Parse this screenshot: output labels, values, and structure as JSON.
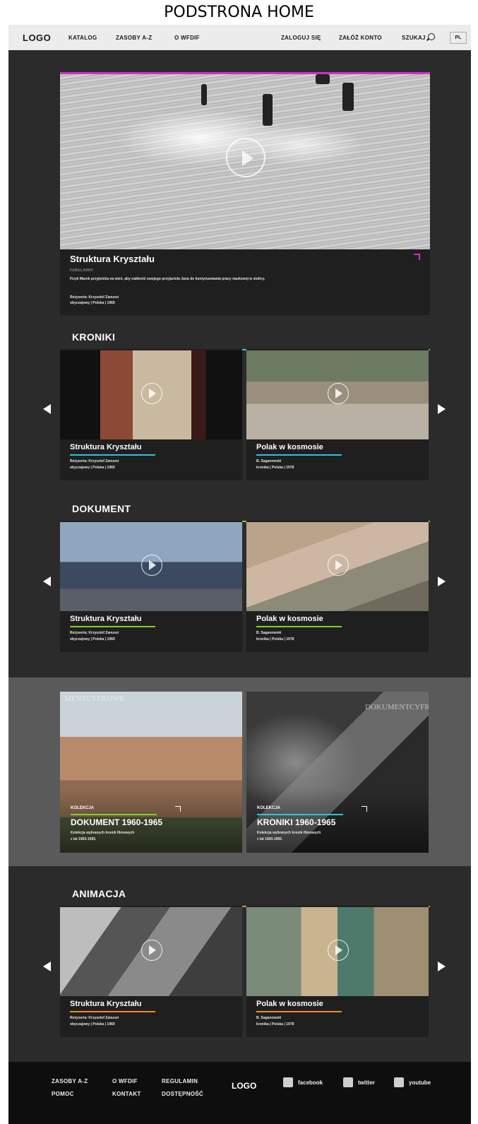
{
  "page_label": "PODSTRONA HOME",
  "nav": {
    "logo": "LOGO",
    "items": [
      "KATALOG",
      "ZASOBY A-Z",
      "O WFDIF"
    ],
    "login": "ZALOGUJ SIĘ",
    "register": "ZAŁÓŻ KONTO",
    "search": "SZUKAJ",
    "lang": "PL"
  },
  "hero": {
    "title": "Struktura Kryształu",
    "genre": "FABULARNY",
    "description": "Fizyk Marek przyjeżdża na wieś, aby nakłonić swojego przyjaciela Jana do kontynuowania pracy naukowej w stolicy.",
    "director": "Reżyseria: Krzysztof Zanussi",
    "info": "obyczajowy | Polska | 1969",
    "accent": "#d22bd0"
  },
  "sections": [
    {
      "title": "KRONIKI",
      "accent": "#2ec4d6",
      "cards": [
        {
          "title": "Struktura Kryształu",
          "line1": "Reżyseria: Krzysztof Zanussi",
          "line2": "obyczajowy | Polska | 1969"
        },
        {
          "title": "Polak w kosmosie",
          "line1": "B. Saganowski",
          "line2": "kronika | Polska | 1978"
        }
      ]
    },
    {
      "title": "DOKUMENT",
      "accent": "#7ed321",
      "cards": [
        {
          "title": "Struktura Kryształu",
          "line1": "Reżyseria: Krzysztof Zanussi",
          "line2": "obyczajowy | Polska | 1969"
        },
        {
          "title": "Polak w kosmosie",
          "line1": "B. Saganowski",
          "line2": "kronika | Polska | 1978"
        }
      ]
    },
    {
      "title": "ANIMACJA",
      "accent": "#f08a1c",
      "cards": [
        {
          "title": "Struktura Kryształu",
          "line1": "Reżyseria: Krzysztof Zanussi",
          "line2": "obyczajowy | Polska | 1969"
        },
        {
          "title": "Polak w kosmosie",
          "line1": "B. Saganowski",
          "line2": "kronika | Polska | 1978"
        }
      ]
    }
  ],
  "collections": [
    {
      "label": "KOLEKCJA",
      "title": "DOKUMENT 1960-1965",
      "desc1": "Kolekcja wybranych kronik filmowych",
      "desc2": "z lat 1960-1965.",
      "accent": "#7ed321",
      "watermark": "MENTCYFROWE"
    },
    {
      "label": "KOLEKCJA",
      "title": "KRONIKI 1960-1965",
      "desc1": "Kolekcja wybranych kronik filmowych",
      "desc2": "z lat 1960-1965.",
      "accent": "#2ec4d6",
      "watermark": "DOKUMENTCYFROW"
    }
  ],
  "footer": {
    "col1": [
      "ZASOBY A-Z",
      "POMOC"
    ],
    "col2": [
      "O WFDIF",
      "KONTAKT"
    ],
    "col3": [
      "REGULAMIN",
      "DOSTĘPNOŚĆ"
    ],
    "logo": "LOGO",
    "social": [
      "facebook",
      "twitter",
      "youtube"
    ]
  }
}
